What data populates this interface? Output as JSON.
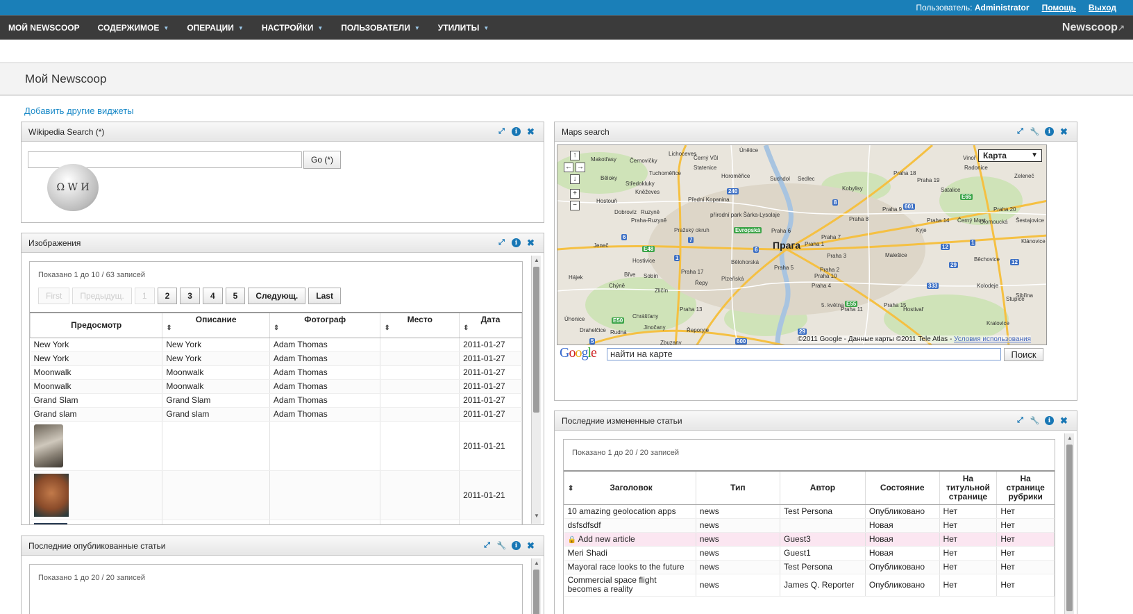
{
  "topbar": {
    "user_label": "Пользователь:",
    "user_name": "Administrator",
    "help": "Помощь",
    "logout": "Выход"
  },
  "nav": {
    "items": [
      "МОЙ NEWSCOOP",
      "СОДЕРЖИМОЕ",
      "ОПЕРАЦИИ",
      "НАСТРОЙКИ",
      "ПОЛЬЗОВАТЕЛИ",
      "УТИЛИТЫ"
    ],
    "logo": "Newscoop"
  },
  "page": {
    "title": "Мой Newscoop",
    "add_widgets": "Добавить другие виджеты"
  },
  "wiki": {
    "title": "Wikipedia Search (*)",
    "button": "Go (*)",
    "logo_letters": "Ω W И"
  },
  "images": {
    "title": "Изображения",
    "count": "Показано 1 до 10 / 63 записей",
    "pager": {
      "first": "First",
      "prev": "Предыдущ.",
      "pages": [
        "1",
        "2",
        "3",
        "4",
        "5"
      ],
      "next": "Следующ.",
      "last": "Last"
    },
    "columns": [
      "Предосмотр",
      "Описание",
      "Фотограф",
      "Место",
      "Дата"
    ],
    "rows": [
      [
        "New York",
        "New York",
        "Adam Thomas",
        "",
        "2011-01-27"
      ],
      [
        "New York",
        "New York",
        "Adam Thomas",
        "",
        "2011-01-27"
      ],
      [
        "Moonwalk",
        "Moonwalk",
        "Adam Thomas",
        "",
        "2011-01-27"
      ],
      [
        "Moonwalk",
        "Moonwalk",
        "Adam Thomas",
        "",
        "2011-01-27"
      ],
      [
        "Grand Slam",
        "Grand Slam",
        "Adam Thomas",
        "",
        "2011-01-27"
      ],
      [
        "Grand slam",
        "Grand slam",
        "Adam Thomas",
        "",
        "2011-01-27"
      ]
    ],
    "thumb_rows": [
      "2011-01-21",
      "2011-01-21"
    ]
  },
  "published": {
    "title": "Последние опубликованные статьи",
    "count": "Показано 1 до 20 / 20 записей"
  },
  "maps": {
    "title": "Maps search",
    "map_type": "Карта",
    "copyright": "©2011 Google - Данные карты ©2011 Tele Atlas -",
    "terms": "Условия использования",
    "google": "Google",
    "search_value": "найти на карте",
    "search_button": "Поиск",
    "city": "Прага",
    "places": [
      "Lichoceves",
      "Únětice",
      "Makotřasy",
      "Černovičky",
      "Černý Vůl",
      "Statenice",
      "Tuchoměřice",
      "Horoměřice",
      "Suchdol",
      "Sedlec",
      "Běloky",
      "Středokluky",
      "Kněževes",
      "Přední Kopanina",
      "Hostouň",
      "Dobrovíz",
      "Ruzyně",
      "Praha-Ruzyně",
      "Praha 6",
      "Praha 7",
      "Praha 8",
      "Praha 9",
      "Praha 18",
      "Praha 19",
      "Praha 14",
      "Praha 20",
      "Kobylisy",
      "Satalice",
      "Vinoř",
      "Radonice",
      "Zeleneč",
      "Šestajovice",
      "Jeneč",
      "Hostivice",
      "Praha 17",
      "Praha 1",
      "Praha 3",
      "Praha 2",
      "Praha 5",
      "Praha 10",
      "Praha 4",
      "Praha 13",
      "Praha 15",
      "Praha 11",
      "Malešice",
      "Kyje",
      "Černý Most",
      "Běchovice",
      "Kolodeje",
      "Sibřina",
      "Stupice",
      "Klánovice",
      "Hájek",
      "Chýně",
      "Břve",
      "Sobín",
      "Zličín",
      "Řepy",
      "Úhonice",
      "Chrášťany",
      "Jinočany",
      "Řeporyje",
      "Drahelčice",
      "Rudná",
      "Zbuzany",
      "Hostivař",
      "Kralovice",
      "přírodní park Šárka-Lysolaje"
    ],
    "roads": [
      "240",
      "8",
      "601",
      "E65",
      "6",
      "7",
      "6",
      "1",
      "E48",
      "12",
      "1",
      "12",
      "29",
      "333",
      "E55",
      "E50",
      "29",
      "5",
      "600",
      "Evropská",
      "Olomoucká",
      "Pražský okruh",
      "Bělohorská",
      "Plzeňská",
      "5. května"
    ]
  },
  "recent": {
    "title": "Последние измененные статьи",
    "count": "Показано 1 до 20 / 20 записей",
    "columns": [
      "Заголовок",
      "Тип",
      "Автор",
      "Состояние",
      "На титульной странице",
      "На странице рубрики"
    ],
    "rows": [
      [
        "10 amazing geolocation apps",
        "news",
        "Test Persona",
        "Опубликовано",
        "Нет",
        "Нет"
      ],
      [
        "dsfsdfsdf",
        "news",
        "",
        "Новая",
        "Нет",
        "Нет"
      ],
      [
        "Add new article",
        "news",
        "Guest3",
        "Новая",
        "Нет",
        "Нет"
      ],
      [
        "Meri Shadi",
        "news",
        "Guest1",
        "Новая",
        "Нет",
        "Нет"
      ],
      [
        "Mayoral race looks to the future",
        "news",
        "Test Persona",
        "Опубликовано",
        "Нет",
        "Нет"
      ],
      [
        "Commercial space flight becomes a reality",
        "news",
        "James Q. Reporter",
        "Опубликовано",
        "Нет",
        "Нет"
      ]
    ],
    "locked_row": 2
  },
  "colors": {
    "accent": "#1a7fb8",
    "nav": "#3b3b3b",
    "locked_row": "#fbe6f1"
  }
}
